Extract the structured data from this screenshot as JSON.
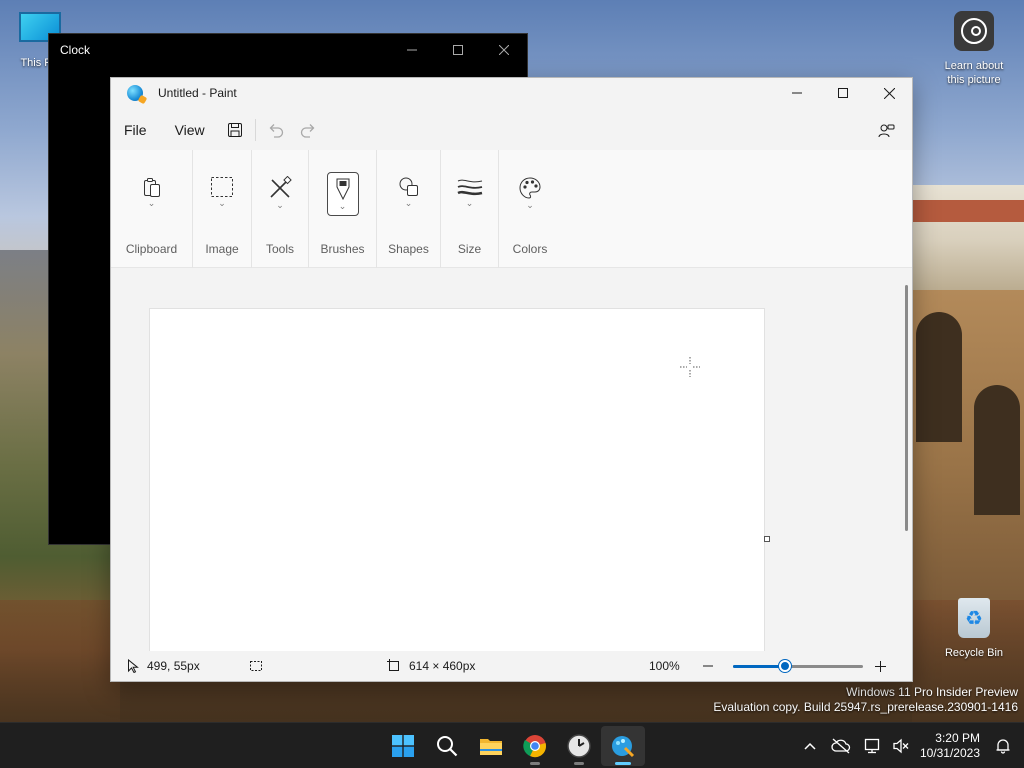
{
  "desktop": {
    "icons": [
      {
        "label": "This PC"
      },
      {
        "label": "Learn about this picture"
      },
      {
        "label": "Recycle Bin"
      }
    ],
    "watermark": {
      "line1": "Windows 11 Pro Insider Preview",
      "line2": "Evaluation copy. Build 25947.rs_prerelease.230901-1416"
    }
  },
  "clock_window": {
    "title": "Clock"
  },
  "paint": {
    "title": "Untitled - Paint",
    "menu": {
      "file": "File",
      "view": "View"
    },
    "ribbon": {
      "groups": [
        {
          "label": "Clipboard",
          "icon": "clipboard-icon"
        },
        {
          "label": "Image",
          "icon": "select-icon"
        },
        {
          "label": "Tools",
          "icon": "tools-icon"
        },
        {
          "label": "Brushes",
          "icon": "brush-icon",
          "selected": true
        },
        {
          "label": "Shapes",
          "icon": "shapes-icon"
        },
        {
          "label": "Size",
          "icon": "size-icon"
        },
        {
          "label": "Colors",
          "icon": "palette-icon"
        }
      ]
    },
    "status": {
      "cursor_position": "499, 55px",
      "canvas_size": "614 × 460px",
      "zoom": "100%",
      "zoom_level": 0.4
    }
  },
  "taskbar": {
    "apps": [
      "start",
      "search",
      "file-explorer",
      "chrome",
      "clock",
      "paint"
    ],
    "time": "3:20 PM",
    "date": "10/31/2023"
  },
  "colors": {
    "accent": "#0067c0",
    "taskbar": "#1f1f1f"
  }
}
